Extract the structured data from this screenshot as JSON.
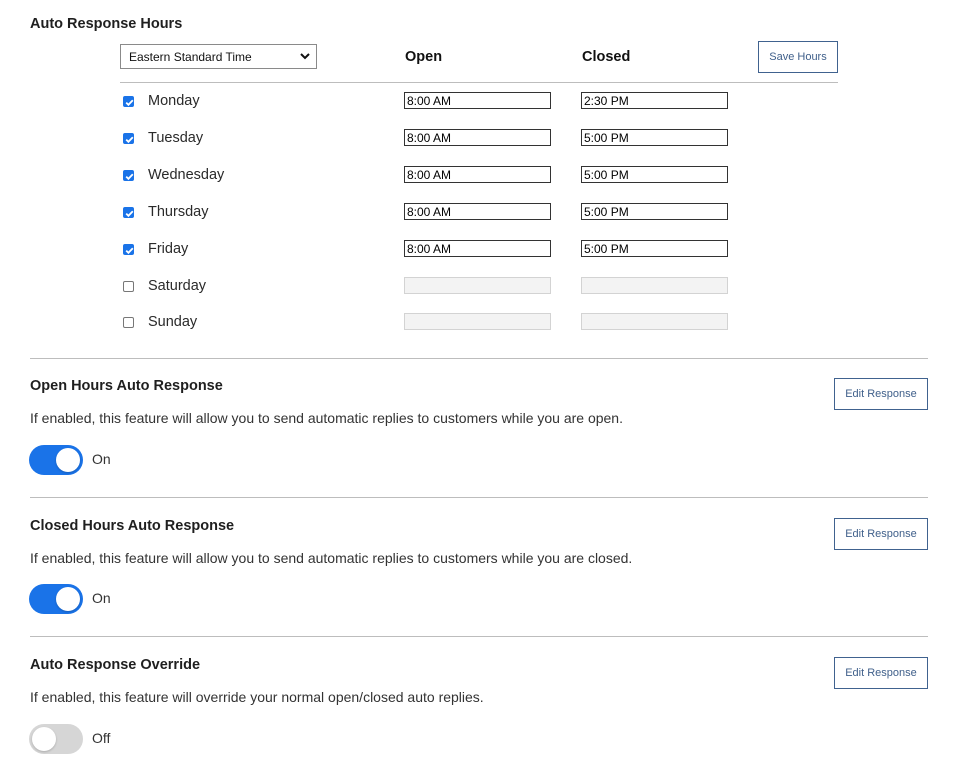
{
  "hours": {
    "title": "Auto Response Hours",
    "timezone": "Eastern Standard Time",
    "open_header": "Open",
    "closed_header": "Closed",
    "save_label": "Save Hours",
    "days": [
      {
        "name": "Monday",
        "checked": true,
        "open": "8:00 AM",
        "closed": "2:30 PM"
      },
      {
        "name": "Tuesday",
        "checked": true,
        "open": "8:00 AM",
        "closed": "5:00 PM"
      },
      {
        "name": "Wednesday",
        "checked": true,
        "open": "8:00 AM",
        "closed": "5:00 PM"
      },
      {
        "name": "Thursday",
        "checked": true,
        "open": "8:00 AM",
        "closed": "5:00 PM"
      },
      {
        "name": "Friday",
        "checked": true,
        "open": "8:00 AM",
        "closed": "5:00 PM"
      },
      {
        "name": "Saturday",
        "checked": false,
        "open": "",
        "closed": ""
      },
      {
        "name": "Sunday",
        "checked": false,
        "open": "",
        "closed": ""
      }
    ]
  },
  "sections": [
    {
      "title": "Open Hours Auto Response",
      "description": "If enabled, this feature will allow you to send automatic replies to customers while you are open.",
      "button_label": "Edit Response",
      "toggle_on": true,
      "toggle_label": "On"
    },
    {
      "title": "Closed Hours Auto Response",
      "description": "If enabled, this feature will allow you to send automatic replies to customers while you are closed.",
      "button_label": "Edit Response",
      "toggle_on": true,
      "toggle_label": "On"
    },
    {
      "title": "Auto Response Override",
      "description": "If enabled, this feature will override your normal open/closed auto replies.",
      "button_label": "Edit Response",
      "toggle_on": false,
      "toggle_label": "Off"
    }
  ],
  "colors": {
    "accent": "#1a73e8",
    "button_border": "#40628f",
    "toggle_off": "#d6d6d6"
  },
  "icons": {
    "checkbox_checked": "check-icon",
    "select_arrow": "chevron-down-icon"
  }
}
